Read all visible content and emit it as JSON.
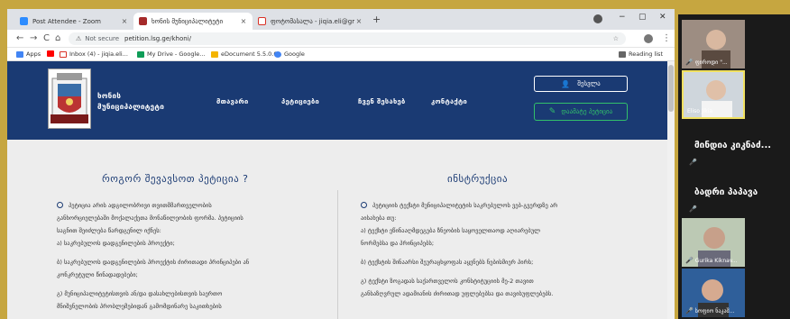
{
  "browser": {
    "tabs": [
      {
        "title": "Post Attendee - Zoom",
        "close": "×",
        "active": false
      },
      {
        "title": "ხონის მუნიციპალიტეტი",
        "close": "×",
        "active": true
      },
      {
        "title": "ფოტომასალა - jiqia.eli@gmail",
        "close": "×",
        "active": false
      }
    ],
    "new_tab": "+",
    "window_controls": {
      "minimize": "−",
      "maximize": "▢",
      "close": "✕"
    },
    "back": "←",
    "forward": "→",
    "reload": "C",
    "home": "⌂",
    "security_label": "Not secure",
    "url": "petition.lsg.ge/khoni/",
    "bookmarks": [
      "Apps",
      "Inbox (4) - jiqia.eli...",
      "My Drive - Google...",
      "eDocument 5.5.0.0",
      "Google"
    ],
    "reading_list": "Reading list"
  },
  "site": {
    "brand_line1": "ხონის",
    "brand_line2": "მუნიციპალიტეტი",
    "nav": [
      "მთავარი",
      "პეტიციები",
      "ჩვენ შესახებ",
      "კონტაქტი"
    ],
    "login_label": "შესვლა",
    "add_petition_label": "დაამატე პეტიცია",
    "left_title": "როგორ შევავსოთ პეტიცია ?",
    "right_title": "ინსტრუქცია",
    "left_lines": [
      "პეტიცია არის ადგილობრივი თვითმმართველობის",
      "განხორციელებაში მოქალაქეთა მონაწილეობის ფორმა. პეტიციის",
      "საგნით შეიძლება წარდგენილ იქნეს:",
      "ა) საკრებულოს დადგენილების პროექტი;",
      "ბ) საკრებულოს დადგენილების პროექტის ძირითადი პრინციპები ან",
      "კონკრეტული წინადადებები;",
      "გ) მუნიციპალიტეტისთვის ან/და დასახლებისთვის საერთო",
      "მნიშვნელობის პრობლემებიდან გამომდინარე საკითხების"
    ],
    "right_lines": [
      "პეტიციის ტექსტი მუნიციპალიტეტის საკრებულოს ვებ-გვერდზე არ",
      "აისახება თუ:",
      "ა) ტექსტი ეწინააღმდეგება ზნეობის საყოველთაოდ აღიარებულ",
      "ნორმებსა და პრინციპებს;",
      "ბ) ტექსტის შინაარსი შეურაცხყოფას აყენებს ნებისმიერ პირს;",
      "გ) ტექსტი ზოგადას საქართველოს კონსტიტუციის მე-2 თავით",
      "განსაზღვრულ ადამიანის ძირითად უფლებებსა და თავისუფლებებს."
    ]
  },
  "zoom": {
    "participants": [
      "ფიროდი \"...",
      "Eliso Jikia",
      "მინდია კიკნაძ...",
      "ბადრი პაპავა",
      "Gurika Kiknav...",
      "სოფიო ნაკაშ..."
    ]
  },
  "colors": {
    "accent": "#1a3a73",
    "green": "#32c06a",
    "zoom_bg": "#1a1a1a",
    "frame": "#c6a640"
  }
}
